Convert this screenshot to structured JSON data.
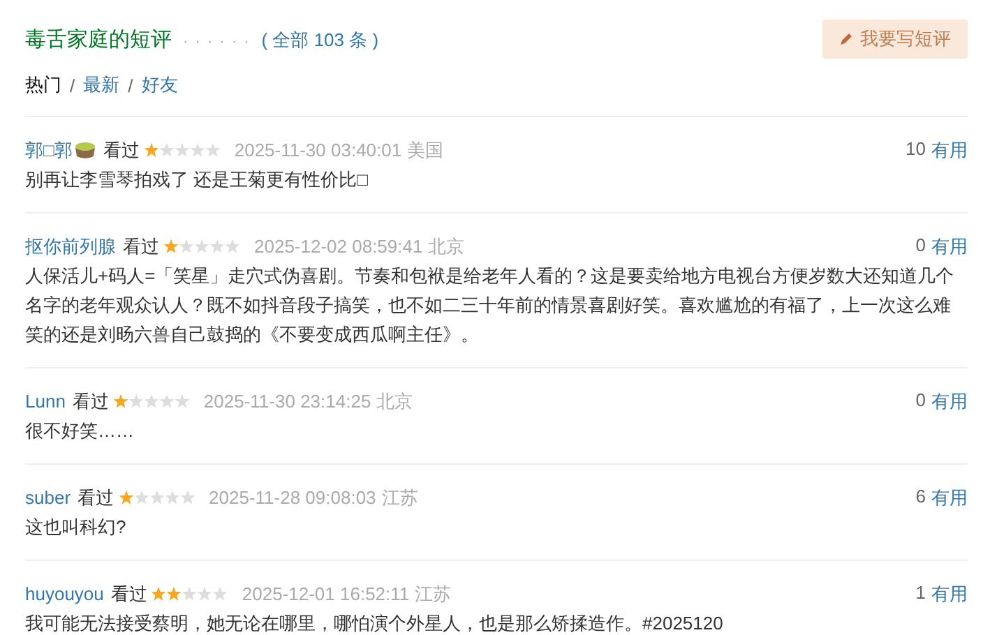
{
  "header": {
    "title": "毒舌家庭的短评",
    "dots": "· · · · · ·",
    "total": "( 全部 103 条 )",
    "write_button": "我要写短评"
  },
  "sort_tabs": [
    {
      "label": "热门",
      "selected": true,
      "separator": "/"
    },
    {
      "label": "最新",
      "selected": false,
      "separator": "/"
    },
    {
      "label": "好友",
      "selected": false
    }
  ],
  "comments": [
    {
      "user": "郭□郭",
      "user_badge": true,
      "status": "看过",
      "stars": 1,
      "time": "2025-11-30 03:40:01",
      "location": "美国",
      "votes": "10",
      "useful": "有用",
      "text": "别再让李雪琴拍戏了 还是王菊更有性价比□"
    },
    {
      "user": "抠你前列腺",
      "user_badge": false,
      "status": "看过",
      "stars": 1,
      "time": "2025-12-02 08:59:41",
      "location": "北京",
      "votes": "0",
      "useful": "有用",
      "text": "人保活儿+码人=「笑星」走穴式伪喜剧。节奏和包袱是给老年人看的？这是要卖给地方电视台方便岁数大还知道几个名字的老年观众认人？既不如抖音段子搞笑，也不如二三十年前的情景喜剧好笑。喜欢尴尬的有福了，上一次这么难笑的还是刘旸六兽自己鼓捣的《不要变成西瓜啊主任》。"
    },
    {
      "user": "Lunn",
      "user_badge": false,
      "status": "看过",
      "stars": 1,
      "time": "2025-11-30 23:14:25",
      "location": "北京",
      "votes": "0",
      "useful": "有用",
      "text": "很不好笑……"
    },
    {
      "user": "suber",
      "user_badge": false,
      "status": "看过",
      "stars": 1,
      "time": "2025-11-28 09:08:03",
      "location": "江苏",
      "votes": "6",
      "useful": "有用",
      "text": "这也叫科幻?"
    },
    {
      "user": "huyouyou",
      "user_badge": false,
      "status": "看过",
      "stars": 2,
      "time": "2025-12-01 16:52:11",
      "location": "江苏",
      "votes": "1",
      "useful": "有用",
      "text": "我可能无法接受蔡明，她无论在哪里，哪怕演个外星人，也是那么矫揉造作。#2025120"
    }
  ]
}
